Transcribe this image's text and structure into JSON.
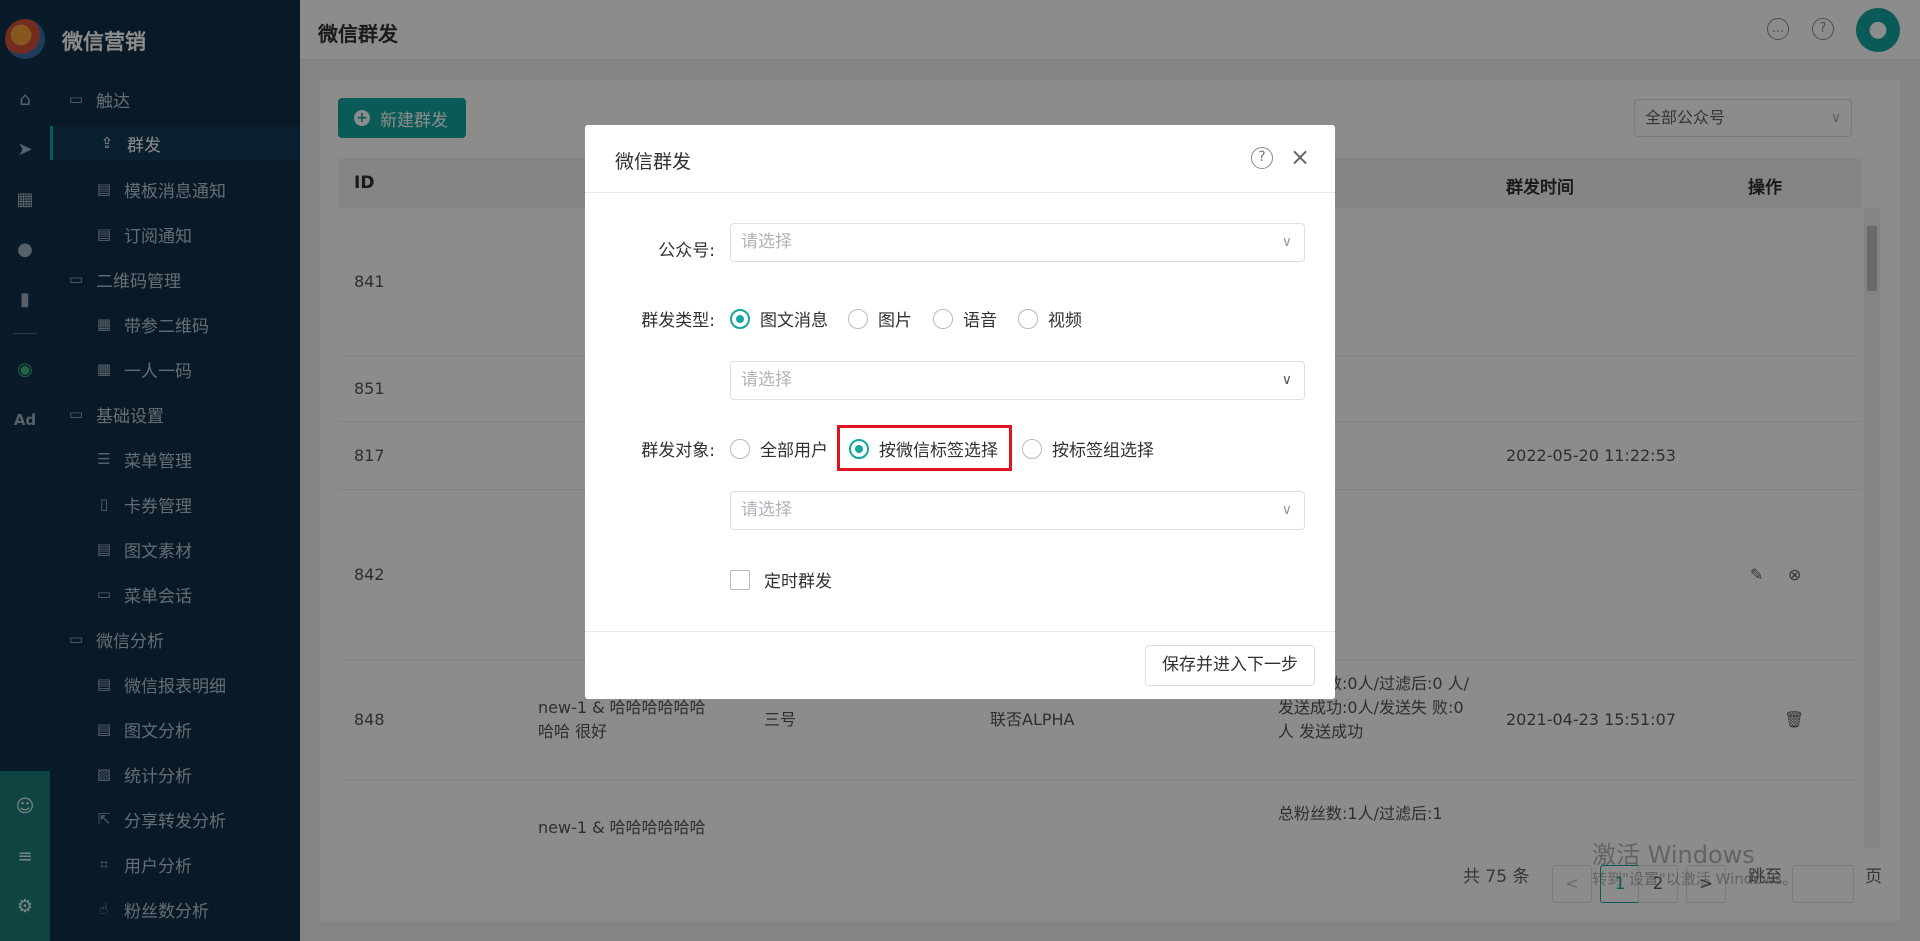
{
  "brand": "微信营销",
  "header": {
    "title": "微信群发"
  },
  "sidebar": {
    "items": [
      {
        "label": "触达"
      },
      {
        "label": "群发"
      },
      {
        "label": "模板消息通知"
      },
      {
        "label": "订阅通知"
      },
      {
        "label": "二维码管理"
      },
      {
        "label": "带参二维码"
      },
      {
        "label": "一人一码"
      },
      {
        "label": "基础设置"
      },
      {
        "label": "菜单管理"
      },
      {
        "label": "卡券管理"
      },
      {
        "label": "图文素材"
      },
      {
        "label": "菜单会话"
      },
      {
        "label": "微信分析"
      },
      {
        "label": "微信报表明细"
      },
      {
        "label": "图文分析"
      },
      {
        "label": "统计分析"
      },
      {
        "label": "分享转发分析"
      },
      {
        "label": "用户分析"
      },
      {
        "label": "粉丝数分析"
      }
    ]
  },
  "rail": {
    "ad_label": "Ad"
  },
  "toolbar": {
    "new_label": "新建群发",
    "account_filter": "全部公众号"
  },
  "table": {
    "headers": {
      "id": "ID",
      "time": "群发时间",
      "action": "操作"
    },
    "rows": [
      {
        "id": "841"
      },
      {
        "id": "851"
      },
      {
        "id": "817",
        "time": "2022-05-20 11:22:53"
      },
      {
        "id": "842"
      },
      {
        "id": "848",
        "content": "new-1 & 哈哈哈哈哈哈 哈哈 很好",
        "account": "三号",
        "source": "联否ALPHA",
        "stats": "总粉丝数:0人/过滤后:0 人/发送成功:0人/发送失 败:0人 发送成功",
        "time": "2021-04-23 15:51:07"
      },
      {
        "content": "new-1 & 哈哈哈哈哈哈",
        "stats": "总粉丝数:1人/过滤后:1"
      }
    ]
  },
  "pagination": {
    "total": "共 75 条",
    "prev": "<",
    "next": ">",
    "pages": [
      "1",
      "2"
    ],
    "jump_label": "跳至",
    "page_unit": "页"
  },
  "watermark": {
    "line1": "激活 Windows",
    "line2": "转到\"设置\"以激活 Windows。"
  },
  "modal": {
    "title": "微信群发",
    "account_label": "公众号:",
    "account_placeholder": "请选择",
    "type_label": "群发类型:",
    "types": [
      "图文消息",
      "图片",
      "语音",
      "视频"
    ],
    "selected_type": "图文消息",
    "content_placeholder": "请选择",
    "target_label": "群发对象:",
    "targets": [
      "全部用户",
      "按微信标签选择",
      "按标签组选择"
    ],
    "selected_target": "按微信标签选择",
    "tag_placeholder": "请选择",
    "schedule_label": "定时群发",
    "save_label": "保存并进入下一步"
  },
  "colors": {
    "accent": "#13a7a0",
    "highlight": "#e0141e",
    "sidebar": "#0f2f47"
  }
}
